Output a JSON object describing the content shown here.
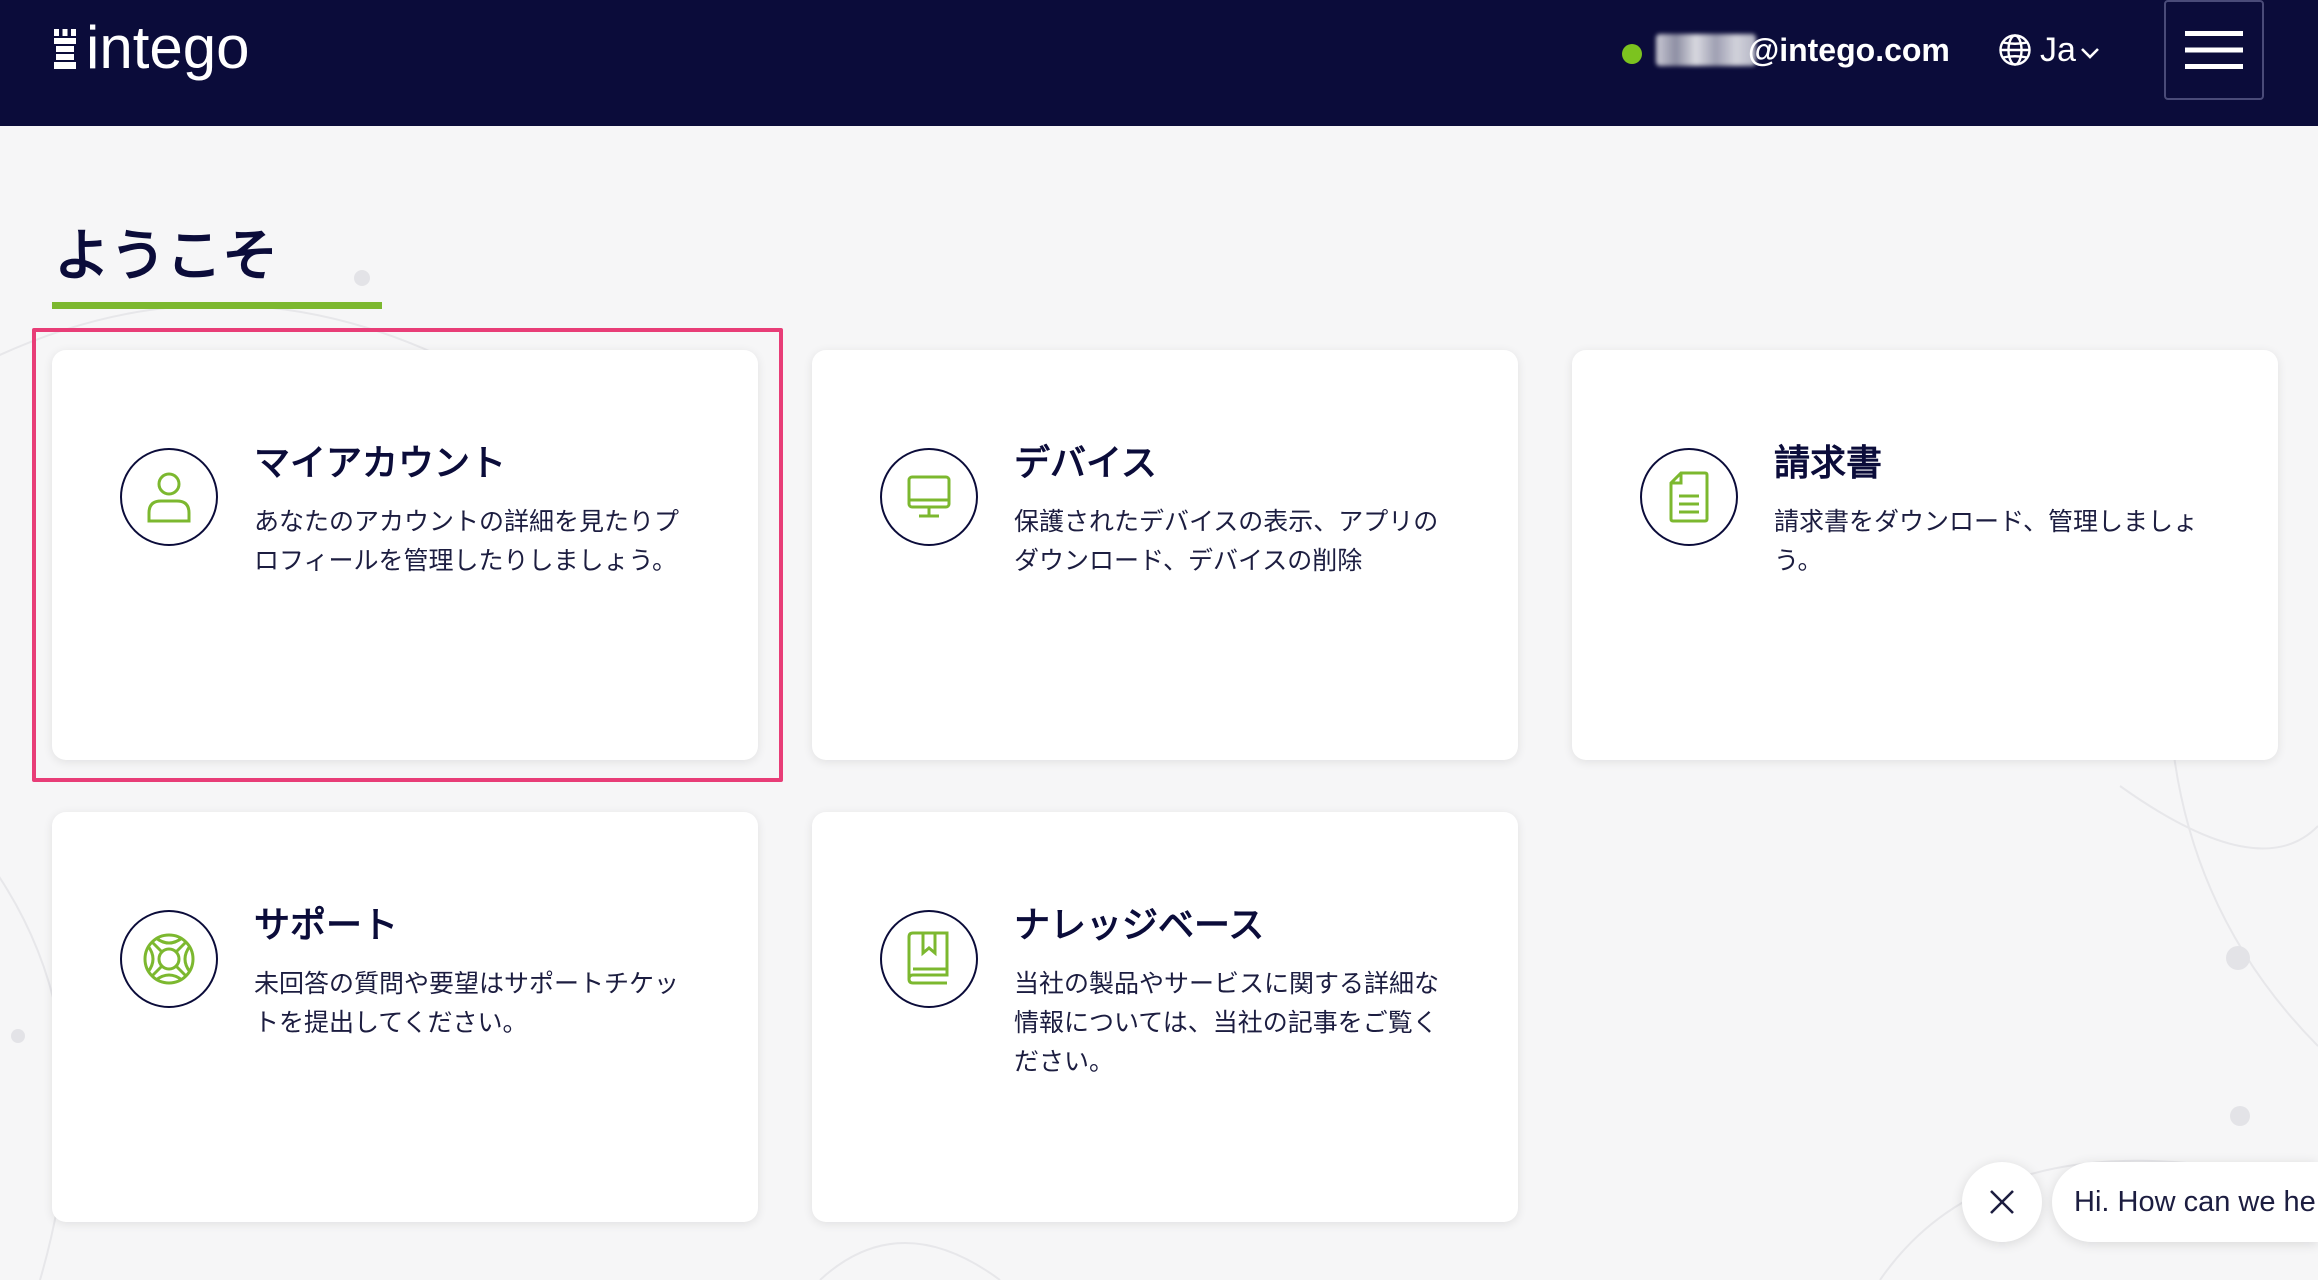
{
  "header": {
    "logo_text": "intego",
    "email_domain": "@intego.com",
    "language_label": "Ja",
    "status_color": "#7cc31f",
    "background_color": "#0b0c3a"
  },
  "main": {
    "title": "ようこそ",
    "accent_color": "#7cb82f",
    "cards": [
      {
        "icon": "user-icon",
        "title": "マイアカウント",
        "description": "あなたのアカウントの詳細を見たりプロフィールを管理したりしましょう。",
        "highlighted": true
      },
      {
        "icon": "monitor-icon",
        "title": "デバイス",
        "description": "保護されたデバイスの表示、アプリのダウンロード、デバイスの削除"
      },
      {
        "icon": "document-icon",
        "title": "請求書",
        "description": "請求書をダウンロード、管理しましょう。"
      },
      {
        "icon": "lifebuoy-icon",
        "title": "サポート",
        "description": "未回答の質問や要望はサポートチケットを提出してください。"
      },
      {
        "icon": "book-icon",
        "title": "ナレッジベース",
        "description": "当社の製品やサービスに関する詳細な情報については、当社の記事をご覧ください。"
      }
    ]
  },
  "chat": {
    "greeting": "Hi. How can we he",
    "close_icon": "close-icon"
  }
}
